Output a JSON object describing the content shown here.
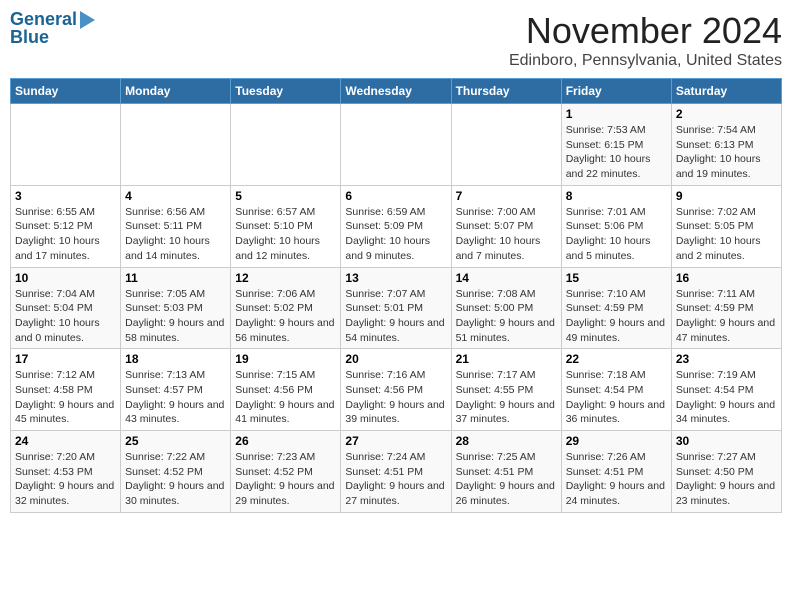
{
  "logo": {
    "line1": "General",
    "line2": "Blue",
    "arrow_color": "#4a90c4"
  },
  "title": "November 2024",
  "subtitle": "Edinboro, Pennsylvania, United States",
  "days_of_week": [
    "Sunday",
    "Monday",
    "Tuesday",
    "Wednesday",
    "Thursday",
    "Friday",
    "Saturday"
  ],
  "weeks": [
    [
      {
        "day": "",
        "info": ""
      },
      {
        "day": "",
        "info": ""
      },
      {
        "day": "",
        "info": ""
      },
      {
        "day": "",
        "info": ""
      },
      {
        "day": "",
        "info": ""
      },
      {
        "day": "1",
        "info": "Sunrise: 7:53 AM\nSunset: 6:15 PM\nDaylight: 10 hours and 22 minutes."
      },
      {
        "day": "2",
        "info": "Sunrise: 7:54 AM\nSunset: 6:13 PM\nDaylight: 10 hours and 19 minutes."
      }
    ],
    [
      {
        "day": "3",
        "info": "Sunrise: 6:55 AM\nSunset: 5:12 PM\nDaylight: 10 hours and 17 minutes."
      },
      {
        "day": "4",
        "info": "Sunrise: 6:56 AM\nSunset: 5:11 PM\nDaylight: 10 hours and 14 minutes."
      },
      {
        "day": "5",
        "info": "Sunrise: 6:57 AM\nSunset: 5:10 PM\nDaylight: 10 hours and 12 minutes."
      },
      {
        "day": "6",
        "info": "Sunrise: 6:59 AM\nSunset: 5:09 PM\nDaylight: 10 hours and 9 minutes."
      },
      {
        "day": "7",
        "info": "Sunrise: 7:00 AM\nSunset: 5:07 PM\nDaylight: 10 hours and 7 minutes."
      },
      {
        "day": "8",
        "info": "Sunrise: 7:01 AM\nSunset: 5:06 PM\nDaylight: 10 hours and 5 minutes."
      },
      {
        "day": "9",
        "info": "Sunrise: 7:02 AM\nSunset: 5:05 PM\nDaylight: 10 hours and 2 minutes."
      }
    ],
    [
      {
        "day": "10",
        "info": "Sunrise: 7:04 AM\nSunset: 5:04 PM\nDaylight: 10 hours and 0 minutes."
      },
      {
        "day": "11",
        "info": "Sunrise: 7:05 AM\nSunset: 5:03 PM\nDaylight: 9 hours and 58 minutes."
      },
      {
        "day": "12",
        "info": "Sunrise: 7:06 AM\nSunset: 5:02 PM\nDaylight: 9 hours and 56 minutes."
      },
      {
        "day": "13",
        "info": "Sunrise: 7:07 AM\nSunset: 5:01 PM\nDaylight: 9 hours and 54 minutes."
      },
      {
        "day": "14",
        "info": "Sunrise: 7:08 AM\nSunset: 5:00 PM\nDaylight: 9 hours and 51 minutes."
      },
      {
        "day": "15",
        "info": "Sunrise: 7:10 AM\nSunset: 4:59 PM\nDaylight: 9 hours and 49 minutes."
      },
      {
        "day": "16",
        "info": "Sunrise: 7:11 AM\nSunset: 4:59 PM\nDaylight: 9 hours and 47 minutes."
      }
    ],
    [
      {
        "day": "17",
        "info": "Sunrise: 7:12 AM\nSunset: 4:58 PM\nDaylight: 9 hours and 45 minutes."
      },
      {
        "day": "18",
        "info": "Sunrise: 7:13 AM\nSunset: 4:57 PM\nDaylight: 9 hours and 43 minutes."
      },
      {
        "day": "19",
        "info": "Sunrise: 7:15 AM\nSunset: 4:56 PM\nDaylight: 9 hours and 41 minutes."
      },
      {
        "day": "20",
        "info": "Sunrise: 7:16 AM\nSunset: 4:56 PM\nDaylight: 9 hours and 39 minutes."
      },
      {
        "day": "21",
        "info": "Sunrise: 7:17 AM\nSunset: 4:55 PM\nDaylight: 9 hours and 37 minutes."
      },
      {
        "day": "22",
        "info": "Sunrise: 7:18 AM\nSunset: 4:54 PM\nDaylight: 9 hours and 36 minutes."
      },
      {
        "day": "23",
        "info": "Sunrise: 7:19 AM\nSunset: 4:54 PM\nDaylight: 9 hours and 34 minutes."
      }
    ],
    [
      {
        "day": "24",
        "info": "Sunrise: 7:20 AM\nSunset: 4:53 PM\nDaylight: 9 hours and 32 minutes."
      },
      {
        "day": "25",
        "info": "Sunrise: 7:22 AM\nSunset: 4:52 PM\nDaylight: 9 hours and 30 minutes."
      },
      {
        "day": "26",
        "info": "Sunrise: 7:23 AM\nSunset: 4:52 PM\nDaylight: 9 hours and 29 minutes."
      },
      {
        "day": "27",
        "info": "Sunrise: 7:24 AM\nSunset: 4:51 PM\nDaylight: 9 hours and 27 minutes."
      },
      {
        "day": "28",
        "info": "Sunrise: 7:25 AM\nSunset: 4:51 PM\nDaylight: 9 hours and 26 minutes."
      },
      {
        "day": "29",
        "info": "Sunrise: 7:26 AM\nSunset: 4:51 PM\nDaylight: 9 hours and 24 minutes."
      },
      {
        "day": "30",
        "info": "Sunrise: 7:27 AM\nSunset: 4:50 PM\nDaylight: 9 hours and 23 minutes."
      }
    ]
  ]
}
